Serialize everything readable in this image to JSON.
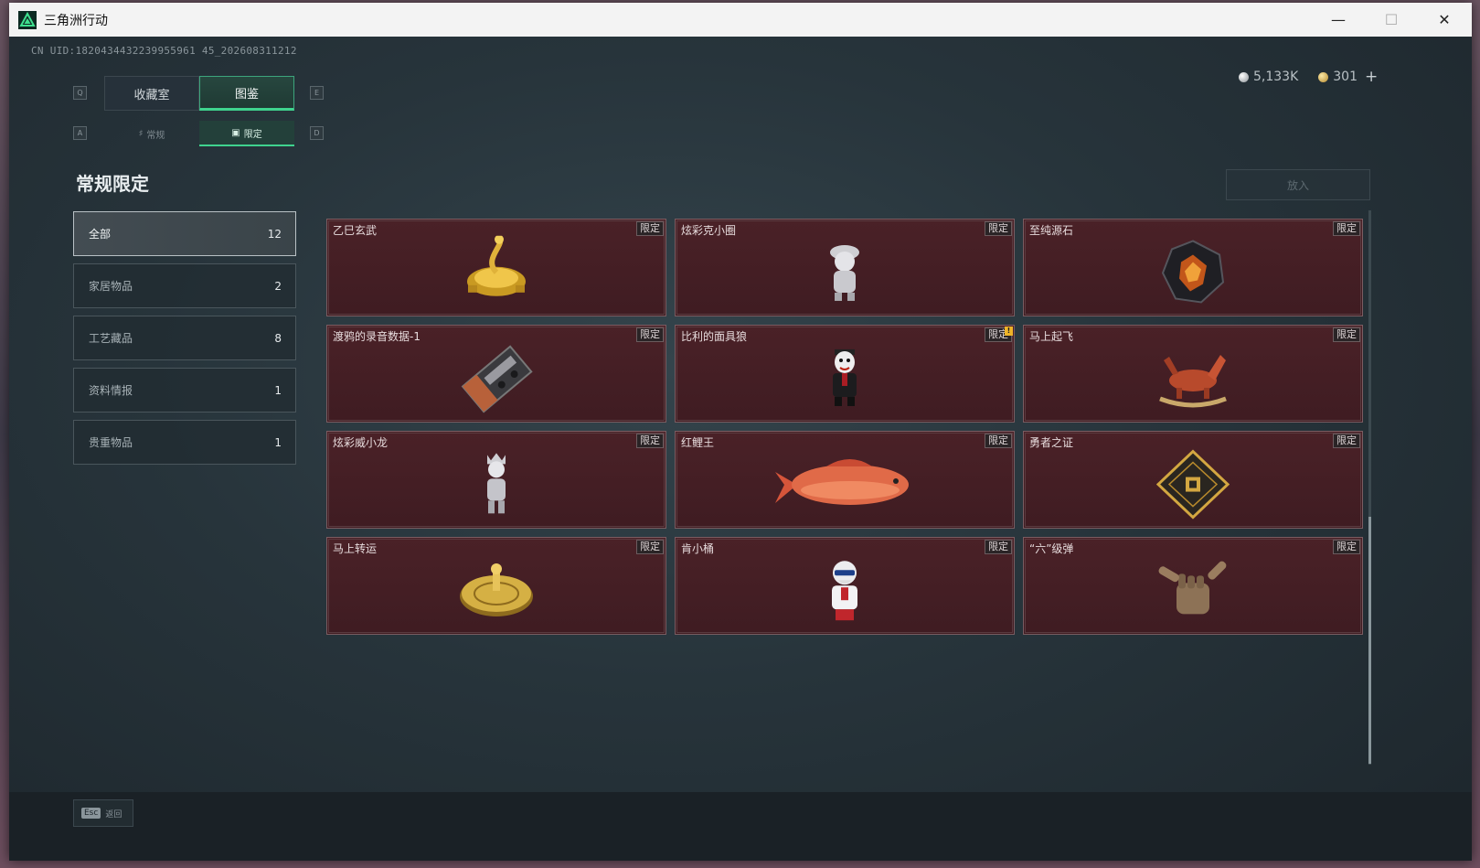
{
  "window": {
    "title": "三角洲行动"
  },
  "header": {
    "uid": "CN UID:1820434432239955961 45_202608311212",
    "silver_amount": "5,133K",
    "gold_amount": "301",
    "add_label": "+"
  },
  "tabs": {
    "prev_key": "Q",
    "next_key": "E",
    "items": [
      {
        "label": "收藏室",
        "active": false
      },
      {
        "label": "图鉴",
        "active": true
      }
    ]
  },
  "sub_tabs": {
    "prev_key": "A",
    "next_key": "D",
    "items": [
      {
        "label": "常规",
        "icon": "flask-icon",
        "active": false
      },
      {
        "label": "限定",
        "icon": "image-icon",
        "active": true
      }
    ]
  },
  "page_title": "常规限定",
  "put_in_label": "放入",
  "categories": [
    {
      "label": "全部",
      "count": "12",
      "active": true
    },
    {
      "label": "家居物品",
      "count": "2",
      "active": false
    },
    {
      "label": "工艺藏品",
      "count": "8",
      "active": false
    },
    {
      "label": "资料情报",
      "count": "1",
      "active": false
    },
    {
      "label": "贵重物品",
      "count": "1",
      "active": false
    }
  ],
  "badge_label": "限定",
  "items": [
    {
      "name": "乙巳玄武",
      "icon": "golden-snake-turtle-icon"
    },
    {
      "name": "炫彩克小圈",
      "icon": "silver-figurine-icon"
    },
    {
      "name": "至纯源石",
      "icon": "amber-gem-icon"
    },
    {
      "name": "渡鸦的录音数据-1",
      "icon": "cassette-tape-icon"
    },
    {
      "name": "比利的面具狼",
      "icon": "puppet-figurine-icon",
      "alert": "!"
    },
    {
      "name": "马上起飞",
      "icon": "rocking-horse-icon"
    },
    {
      "name": "炫彩威小龙",
      "icon": "silver-doll-icon"
    },
    {
      "name": "红鲤王",
      "icon": "red-carp-icon"
    },
    {
      "name": "勇者之证",
      "icon": "gold-card-icon"
    },
    {
      "name": "马上转运",
      "icon": "fortune-wheel-icon"
    },
    {
      "name": "肯小桶",
      "icon": "colonel-figurine-icon"
    },
    {
      "name": "“六”级弹",
      "icon": "shaka-hand-icon"
    }
  ],
  "footer": {
    "esc_key": "Esc",
    "back_label": "返回"
  }
}
